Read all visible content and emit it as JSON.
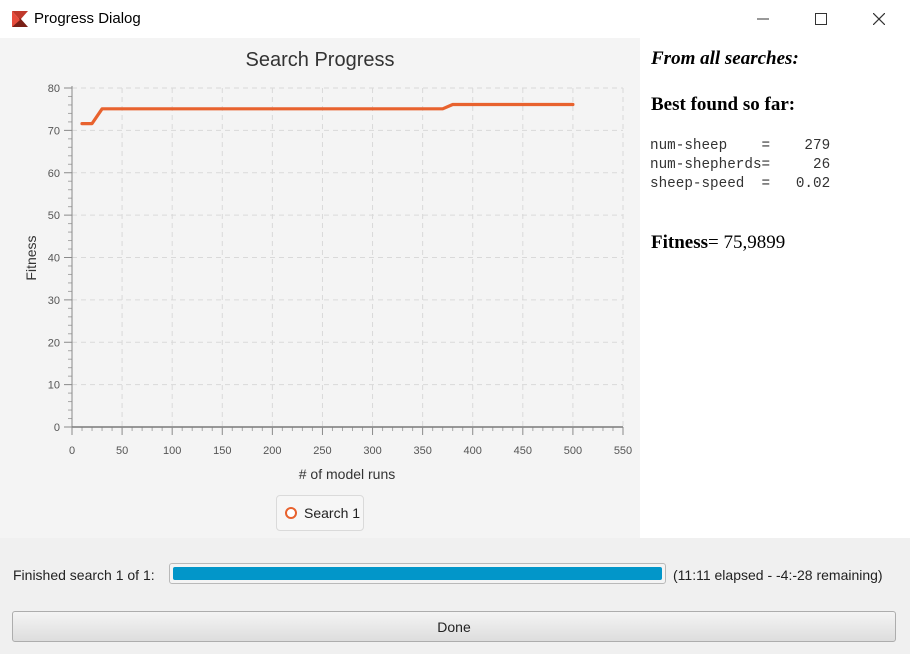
{
  "window": {
    "title": "Progress Dialog",
    "minimize_symbol": "—",
    "maximize_symbol": "☐",
    "close_symbol": "✕"
  },
  "chart_data": {
    "type": "line",
    "title": "Search Progress",
    "xlabel": "# of model runs",
    "ylabel": "Fitness",
    "xlim": [
      0,
      550
    ],
    "ylim": [
      0,
      80
    ],
    "x_ticks": [
      0,
      50,
      100,
      150,
      200,
      250,
      300,
      350,
      400,
      450,
      500,
      550
    ],
    "y_ticks": [
      0,
      10,
      20,
      30,
      40,
      50,
      60,
      70,
      80
    ],
    "grid": true,
    "legend_position": "bottom",
    "series": [
      {
        "name": "Search 1",
        "color": "#e8622e",
        "x": [
          10,
          20,
          30,
          370,
          380,
          500
        ],
        "y": [
          71.6,
          71.6,
          75.1,
          75.1,
          76.1,
          76.1
        ]
      }
    ]
  },
  "info": {
    "header": "From all searches:",
    "best_label": "Best found so far:",
    "params": [
      "num-sheep    =    279",
      "num-shepherds=     26",
      "sheep-speed  =   0.02"
    ],
    "fitness_label": "Fitness",
    "fitness_value": "= 75,9899"
  },
  "status": {
    "label": "Finished search 1 of 1:",
    "progress_fraction": 1.0,
    "time_text": "(11:11 elapsed - -4:-28 remaining)"
  },
  "done_button": {
    "label": "Done"
  }
}
